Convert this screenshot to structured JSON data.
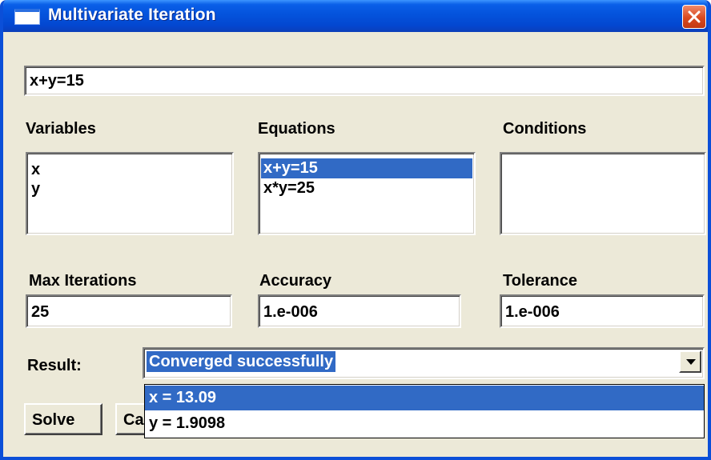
{
  "window": {
    "title": "Multivariate Iteration",
    "icon": "window-icon",
    "close_icon": "close-icon"
  },
  "equation_input": {
    "value": "x+y=15"
  },
  "variables": {
    "label": "Variables",
    "items": [
      "x",
      "y"
    ]
  },
  "equations": {
    "label": "Equations",
    "items": [
      "x+y=15",
      "x*y=25"
    ],
    "selected_index": 0
  },
  "conditions": {
    "label": "Conditions",
    "items": []
  },
  "max_iterations": {
    "label": "Max Iterations",
    "value": "25"
  },
  "accuracy": {
    "label": "Accuracy",
    "value": "1.e-006"
  },
  "tolerance": {
    "label": "Tolerance",
    "value": "1.e-006"
  },
  "result": {
    "label": "Result:",
    "value": "Converged successfully",
    "options": [
      "x = 13.09",
      "y = 1.9098"
    ],
    "highlighted_index": 0
  },
  "buttons": {
    "solve": "Solve",
    "cancel_partial": "Ca"
  },
  "colors": {
    "titlebar": "#0453dc",
    "selection": "#316ac5",
    "dialog_bg": "#ece9d8",
    "close": "#d9491f"
  }
}
